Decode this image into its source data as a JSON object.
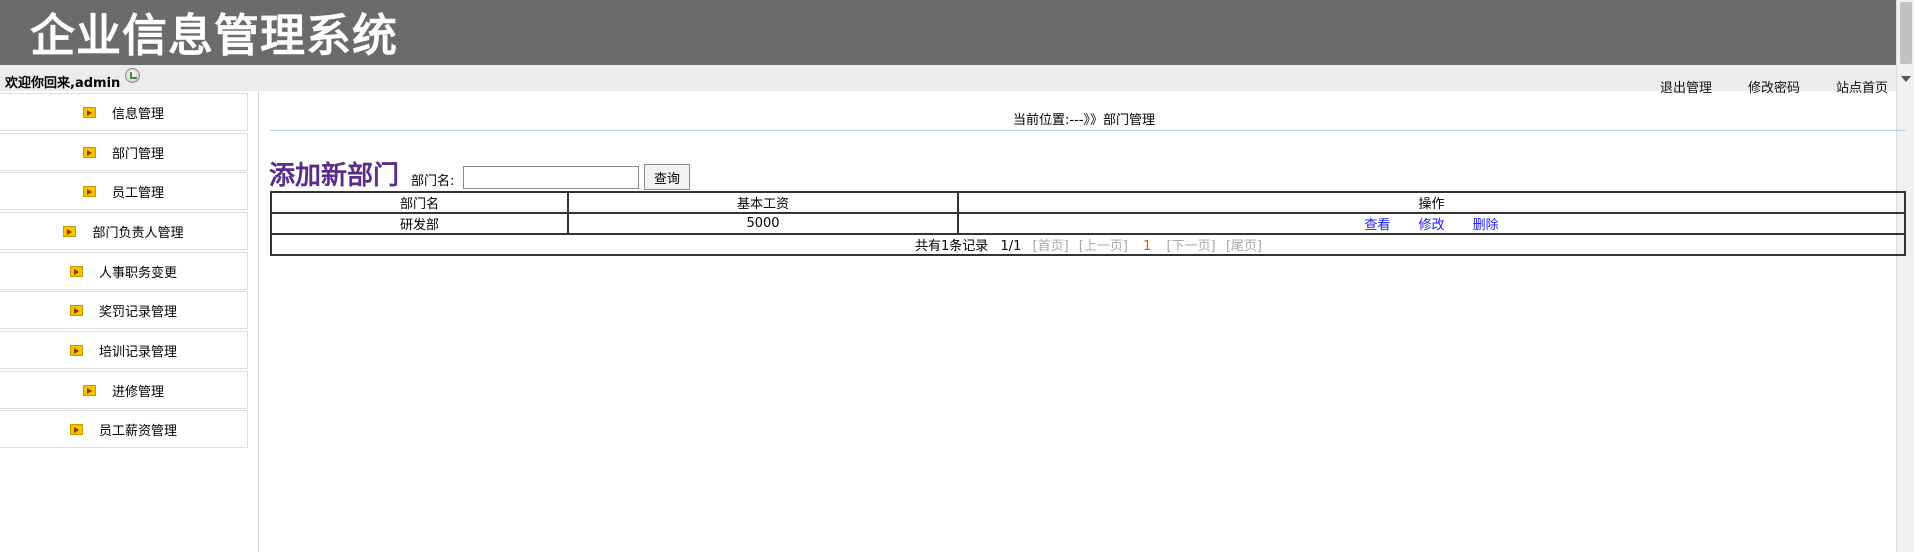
{
  "app": {
    "title": "企业信息管理系统"
  },
  "topbar": {
    "welcome": "欢迎你回来,admin",
    "links": [
      "退出管理",
      "修改密码",
      "站点首页"
    ]
  },
  "sidebar": {
    "items": [
      {
        "label": "信息管理"
      },
      {
        "label": "部门管理"
      },
      {
        "label": "员工管理"
      },
      {
        "label": "部门负责人管理"
      },
      {
        "label": "人事职务变更"
      },
      {
        "label": "奖罚记录管理"
      },
      {
        "label": "培训记录管理"
      },
      {
        "label": "进修管理"
      },
      {
        "label": "员工薪资管理"
      }
    ]
  },
  "main": {
    "breadcrumb": "当前位置:---》》部门管理",
    "add_link": "添加新部门",
    "search": {
      "label": "部门名:",
      "value": "",
      "button": "查询"
    },
    "table": {
      "headers": [
        "部门名",
        "基本工资",
        "操作"
      ],
      "rows": [
        {
          "name": "研发部",
          "salary": "5000",
          "actions": [
            "查看",
            "修改",
            "删除"
          ]
        }
      ]
    },
    "pager": {
      "summary": "共有1条记录",
      "page": "1/1",
      "first": "[首页]",
      "prev": "[上一页]",
      "current": "1",
      "next": "[下一页]",
      "last": "[尾页]"
    }
  }
}
